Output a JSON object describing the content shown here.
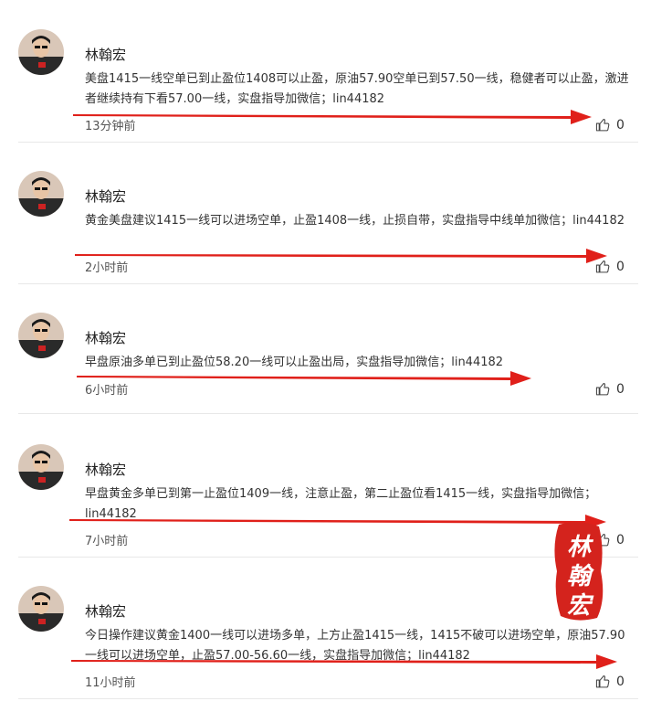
{
  "posts": [
    {
      "author": "林翰宏",
      "content": "美盘1415一线空单已到止盈位1408可以止盈，原油57.90空单已到57.50一线，稳健者可以止盈，激进者继续持有下看57.00一线，实盘指导加微信；lin44182",
      "time": "13分钟前",
      "likes": "0"
    },
    {
      "author": "林翰宏",
      "content": "黄金美盘建议1415一线可以进场空单，止盈1408一线，止损自带，实盘指导中线单加微信；lin44182",
      "time": "2小时前",
      "likes": "0"
    },
    {
      "author": "林翰宏",
      "content": "早盘原油多单已到止盈位58.20一线可以止盈出局，实盘指导加微信；lin44182",
      "time": "6小时前",
      "likes": "0"
    },
    {
      "author": "林翰宏",
      "content": "早盘黄金多单已到第一止盈位1409一线，注意止盈，第二止盈位看1415一线，实盘指导加微信；lin44182",
      "time": "7小时前",
      "likes": "0"
    },
    {
      "author": "林翰宏",
      "content": "今日操作建议黄金1400一线可以进场多单，上方止盈1415一线，1415不破可以进场空单，原油57.90一线可以进场空单，止盈57.00-56.60一线，实盘指导加微信；lin44182",
      "time": "11小时前",
      "likes": "0"
    }
  ],
  "seal": {
    "chars": [
      "林",
      "翰",
      "宏"
    ]
  },
  "colors": {
    "accent": "#e0201a",
    "text": "#333333",
    "divider": "#e8e8e8"
  }
}
